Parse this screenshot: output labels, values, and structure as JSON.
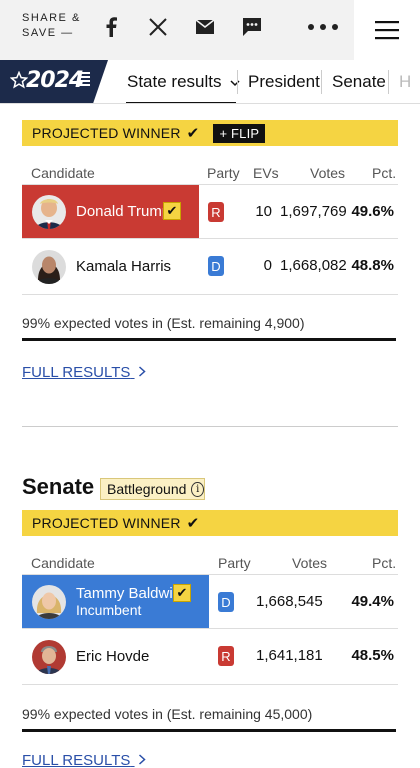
{
  "topbar": {
    "share_label": "SHARE &\nSAVE —",
    "icons": [
      "facebook-icon",
      "x-icon",
      "mail-icon",
      "comment-icon",
      "more-icon",
      "menu-icon"
    ]
  },
  "nav": {
    "logo_text": "2024",
    "items": [
      "State results",
      "President",
      "Senate",
      "H"
    ]
  },
  "president": {
    "banner_label": "PROJECTED WINNER",
    "flip_label": "+ FLIP",
    "headers": {
      "candidate": "Candidate",
      "party": "Party",
      "evs": "EVs",
      "votes": "Votes",
      "pct": "Pct."
    },
    "rows": [
      {
        "name": "Donald Trump",
        "party": "R",
        "evs": "10",
        "votes": "1,697,769",
        "pct": "49.6%"
      },
      {
        "name": "Kamala Harris",
        "party": "D",
        "evs": "0",
        "votes": "1,668,082",
        "pct": "48.8%"
      }
    ],
    "note": "99% expected votes in (Est. remaining 4,900)",
    "full_results": "FULL RESULTS"
  },
  "senate": {
    "title": "Senate",
    "tag": "Battleground",
    "banner_label": "PROJECTED WINNER",
    "headers": {
      "candidate": "Candidate",
      "party": "Party",
      "votes": "Votes",
      "pct": "Pct."
    },
    "rows": [
      {
        "name": "Tammy Baldwin",
        "sub": "Incumbent",
        "party": "D",
        "votes": "1,668,545",
        "pct": "49.4%"
      },
      {
        "name": "Eric Hovde",
        "party": "R",
        "votes": "1,641,181",
        "pct": "48.5%"
      }
    ],
    "note": "99% expected votes in (Est. remaining 45,000)",
    "full_results": "FULL RESULTS"
  },
  "colors": {
    "republican": "#c93a33",
    "democrat": "#3a7bd5",
    "winner_yellow": "#f5d442",
    "navy": "#1c2a4a"
  }
}
